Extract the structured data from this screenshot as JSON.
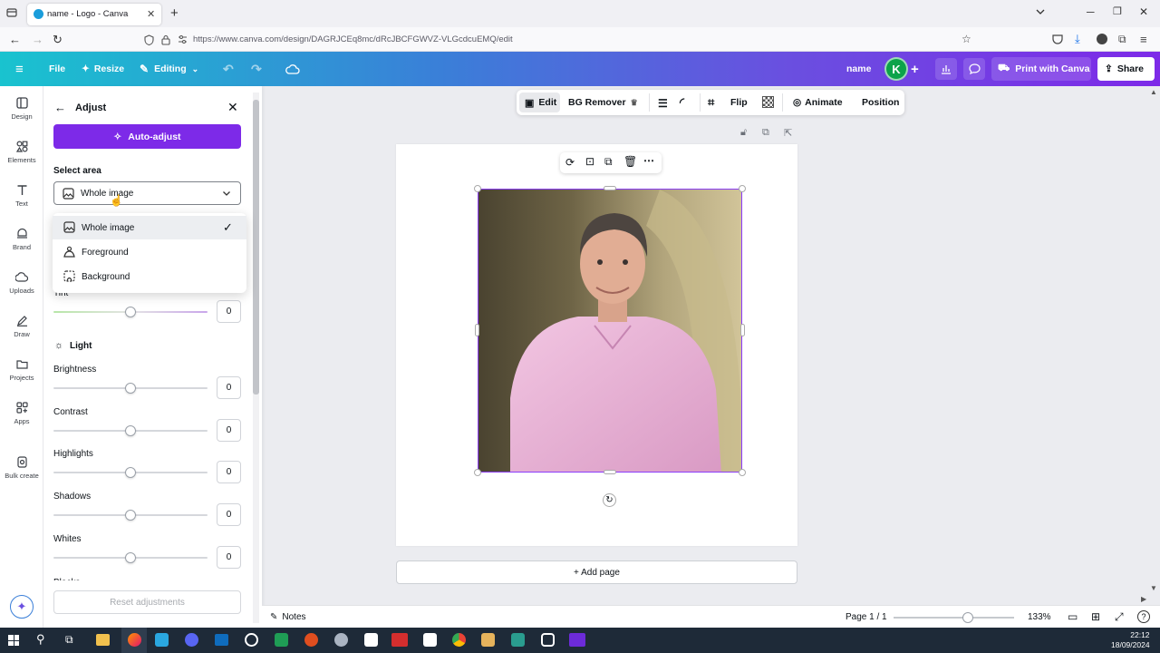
{
  "browser": {
    "tab_title": "name - Logo - Canva",
    "url": "https://www.canva.com/design/DAGRJCEq8mc/dRcJBCFGWVZ-VLGcdcuEMQ/edit"
  },
  "header": {
    "file": "File",
    "resize": "Resize",
    "editing": "Editing",
    "design_name": "name",
    "avatar_letter": "K",
    "print": "Print with Canva",
    "share": "Share"
  },
  "rail": [
    {
      "label": "Design",
      "icon": "design-icon"
    },
    {
      "label": "Elements",
      "icon": "elements-icon"
    },
    {
      "label": "Text",
      "icon": "text-icon"
    },
    {
      "label": "Brand",
      "icon": "brand-icon"
    },
    {
      "label": "Uploads",
      "icon": "uploads-icon"
    },
    {
      "label": "Draw",
      "icon": "draw-icon"
    },
    {
      "label": "Projects",
      "icon": "projects-icon"
    },
    {
      "label": "Apps",
      "icon": "apps-icon"
    },
    {
      "label": "Bulk create",
      "icon": "bulk-create-icon"
    }
  ],
  "panel": {
    "title": "Adjust",
    "auto_adjust": "Auto-adjust",
    "select_area_label": "Select area",
    "select_value": "Whole image",
    "options": [
      "Whole image",
      "Foreground",
      "Background"
    ],
    "tint_label": "Tint",
    "light_section": "Light",
    "sliders": [
      {
        "label": "Brightness",
        "value": "0"
      },
      {
        "label": "Contrast",
        "value": "0"
      },
      {
        "label": "Highlights",
        "value": "0"
      },
      {
        "label": "Shadows",
        "value": "0"
      },
      {
        "label": "Whites",
        "value": "0"
      }
    ],
    "tint_value": "0",
    "cut_label": "Blacks",
    "reset": "Reset adjustments"
  },
  "toolbar": {
    "edit": "Edit",
    "bg_remover": "BG Remover",
    "flip": "Flip",
    "animate": "Animate",
    "position": "Position"
  },
  "canvas": {
    "add_page": "+ Add page"
  },
  "footer": {
    "notes": "Notes",
    "page": "Page 1 / 1",
    "zoom": "133%",
    "zoom_level": 0.62
  },
  "taskbar": {
    "time": "22:12",
    "date": "18/09/2024"
  },
  "colors": {
    "accent": "#7d2ae8",
    "avatar": "#0ca34a"
  }
}
